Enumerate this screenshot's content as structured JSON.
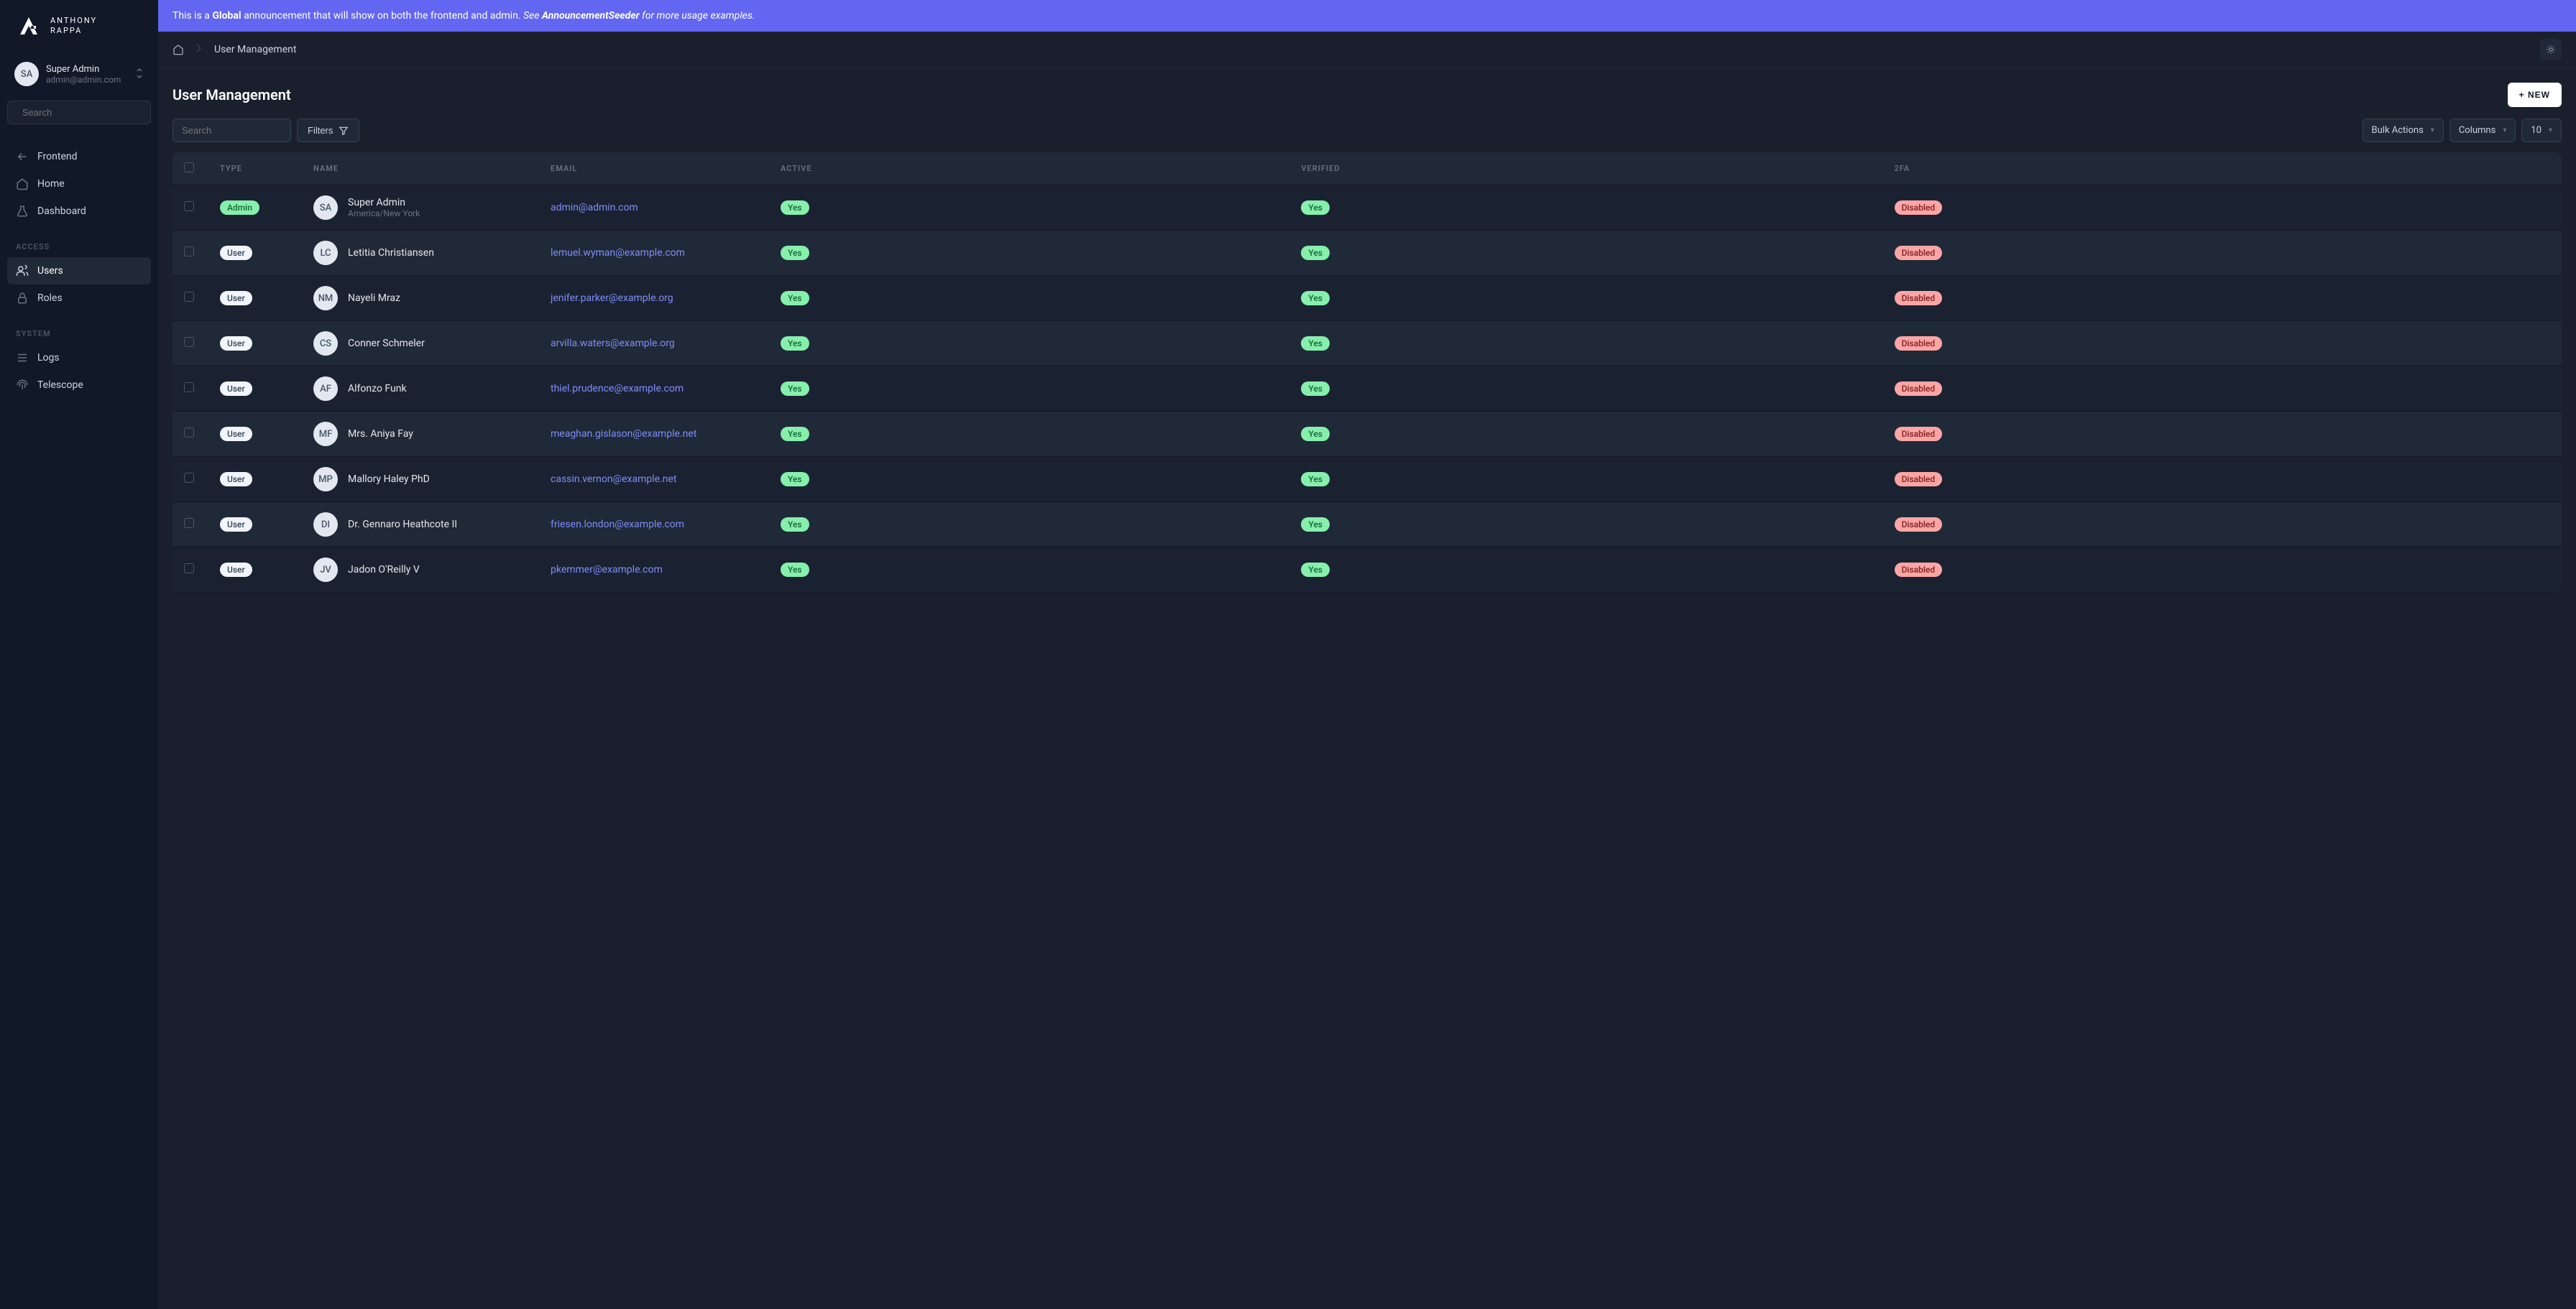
{
  "brand": {
    "line1": "ANTHONY",
    "line2": "RAPPA"
  },
  "current_user": {
    "initials": "SA",
    "name": "Super Admin",
    "email": "admin@admin.com"
  },
  "sidebar": {
    "search_placeholder": "Search",
    "items": [
      {
        "label": "Frontend",
        "icon": "arrow-left"
      },
      {
        "label": "Home",
        "icon": "home"
      },
      {
        "label": "Dashboard",
        "icon": "beaker"
      }
    ],
    "sections": [
      {
        "label": "ACCESS",
        "items": [
          {
            "label": "Users",
            "icon": "users",
            "active": true
          },
          {
            "label": "Roles",
            "icon": "lock"
          }
        ]
      },
      {
        "label": "SYSTEM",
        "items": [
          {
            "label": "Logs",
            "icon": "list"
          },
          {
            "label": "Telescope",
            "icon": "fingerprint"
          }
        ]
      }
    ]
  },
  "announcement": {
    "prefix": "This is a ",
    "bold1": "Global",
    "mid": " announcement that will show on both the frontend and admin. ",
    "see": "See ",
    "seeder": "AnnouncementSeeder",
    "suffix": " for more usage examples."
  },
  "breadcrumb": {
    "item": "User Management"
  },
  "page": {
    "title": "User Management",
    "new_button": "+ NEW"
  },
  "toolbar": {
    "search_placeholder": "Search",
    "filters": "Filters",
    "bulk_actions": "Bulk Actions",
    "columns": "Columns",
    "page_size": "10"
  },
  "table": {
    "headers": {
      "type": "TYPE",
      "name": "NAME",
      "email": "EMAIL",
      "active": "ACTIVE",
      "verified": "VERIFIED",
      "twofa": "2FA"
    },
    "rows": [
      {
        "type": "Admin",
        "initials": "SA",
        "name": "Super Admin",
        "sub": "America/New York",
        "email": "admin@admin.com",
        "active": "Yes",
        "verified": "Yes",
        "twofa": "Disabled"
      },
      {
        "type": "User",
        "initials": "LC",
        "name": "Letitia Christiansen",
        "sub": "",
        "email": "lemuel.wyman@example.com",
        "active": "Yes",
        "verified": "Yes",
        "twofa": "Disabled"
      },
      {
        "type": "User",
        "initials": "NM",
        "name": "Nayeli Mraz",
        "sub": "",
        "email": "jenifer.parker@example.org",
        "active": "Yes",
        "verified": "Yes",
        "twofa": "Disabled"
      },
      {
        "type": "User",
        "initials": "CS",
        "name": "Conner Schmeler",
        "sub": "",
        "email": "arvilla.waters@example.org",
        "active": "Yes",
        "verified": "Yes",
        "twofa": "Disabled"
      },
      {
        "type": "User",
        "initials": "AF",
        "name": "Alfonzo Funk",
        "sub": "",
        "email": "thiel.prudence@example.com",
        "active": "Yes",
        "verified": "Yes",
        "twofa": "Disabled"
      },
      {
        "type": "User",
        "initials": "MF",
        "name": "Mrs. Aniya Fay",
        "sub": "",
        "email": "meaghan.gislason@example.net",
        "active": "Yes",
        "verified": "Yes",
        "twofa": "Disabled"
      },
      {
        "type": "User",
        "initials": "MP",
        "name": "Mallory Haley PhD",
        "sub": "",
        "email": "cassin.vernon@example.net",
        "active": "Yes",
        "verified": "Yes",
        "twofa": "Disabled"
      },
      {
        "type": "User",
        "initials": "DI",
        "name": "Dr. Gennaro Heathcote II",
        "sub": "",
        "email": "friesen.london@example.com",
        "active": "Yes",
        "verified": "Yes",
        "twofa": "Disabled"
      },
      {
        "type": "User",
        "initials": "JV",
        "name": "Jadon O'Reilly V",
        "sub": "",
        "email": "pkemmer@example.com",
        "active": "Yes",
        "verified": "Yes",
        "twofa": "Disabled"
      }
    ]
  }
}
